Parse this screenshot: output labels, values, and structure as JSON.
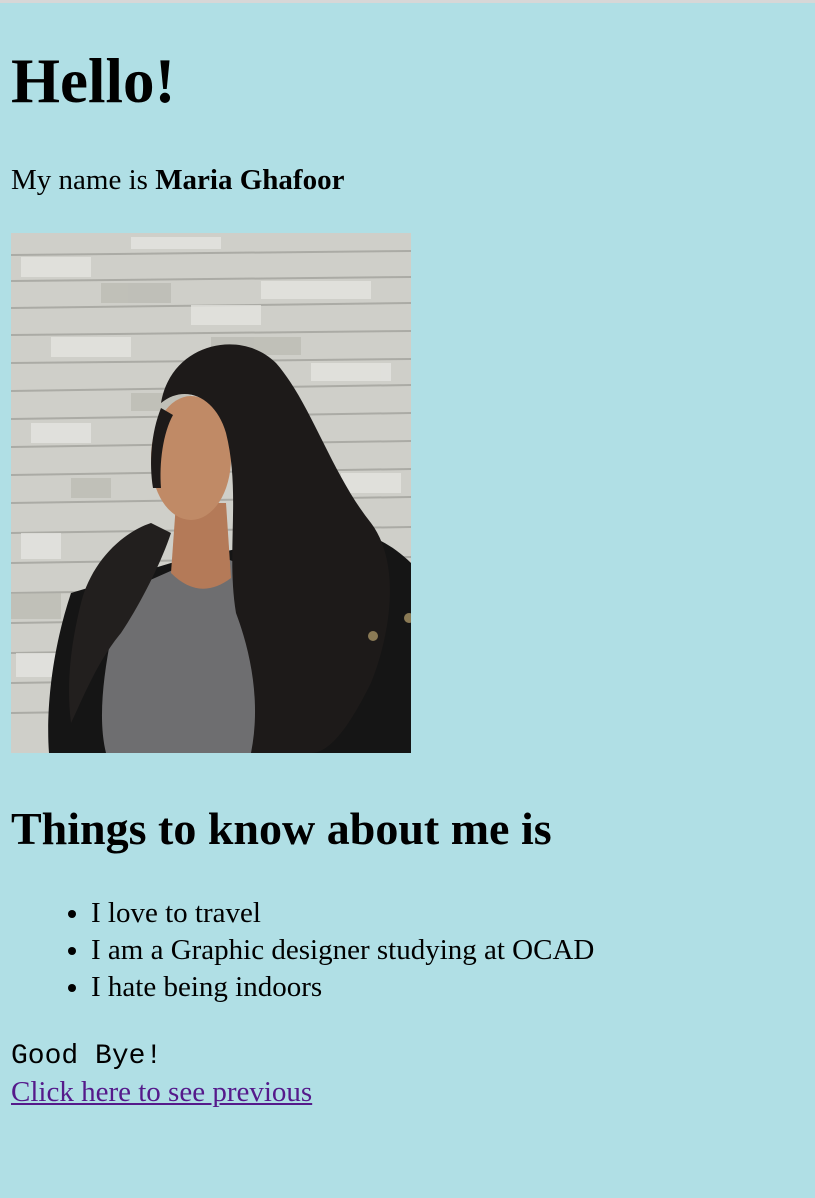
{
  "header": {
    "greeting": "Hello!"
  },
  "intro": {
    "prefix": "My name is ",
    "name": "Maria Ghafoor"
  },
  "photo": {
    "alt": "Portrait photo in front of a stone wall"
  },
  "facts": {
    "heading": "Things to know about me is",
    "items": [
      "I love to travel",
      "I am a Graphic designer studying at OCAD",
      "I hate being indoors"
    ]
  },
  "footer": {
    "goodbye": "Good Bye!",
    "link_label": "Click here to see previous"
  },
  "colors": {
    "background": "#b0dfe5",
    "visited_link": "#551a8b"
  }
}
